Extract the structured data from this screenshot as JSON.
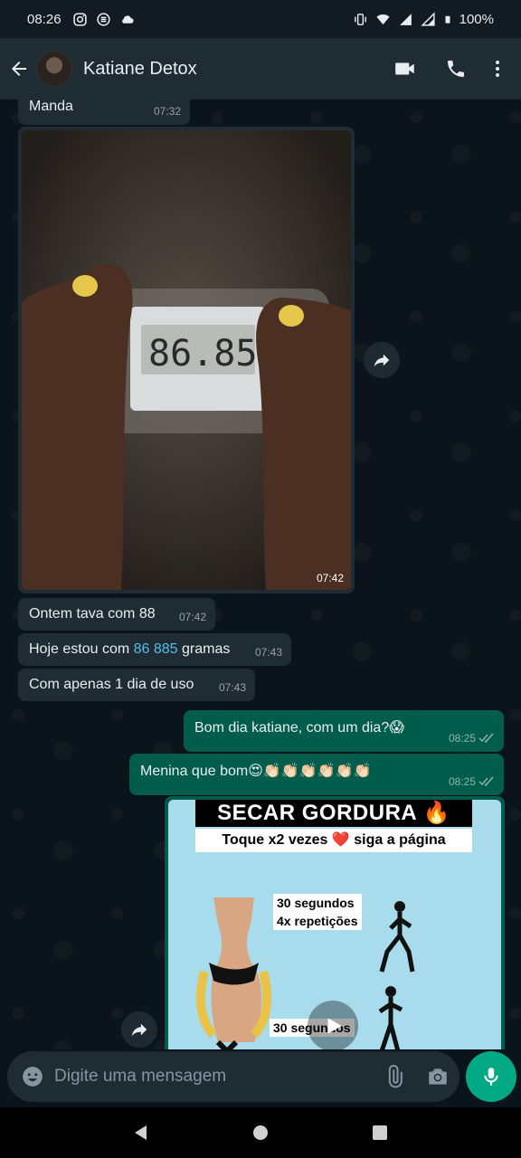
{
  "status_bar": {
    "time": "08:26",
    "battery": "100%"
  },
  "header": {
    "contact_name": "Katiane Detox"
  },
  "messages": [
    {
      "dir": "in",
      "text": "Manda",
      "time": "07:32"
    },
    {
      "dir": "in",
      "type": "image",
      "time": "07:42"
    },
    {
      "dir": "in",
      "text": "Ontem tava com 88",
      "time": "07:42"
    },
    {
      "dir": "in",
      "text_before": "Hoje estou com ",
      "link": "86 885",
      "text_after": " gramas",
      "time": "07:43"
    },
    {
      "dir": "in",
      "text": "Com apenas 1 dia de uso",
      "time": "07:43"
    },
    {
      "dir": "out",
      "text": "Bom dia katiane, com um dia?😱",
      "time": "08:25"
    },
    {
      "dir": "out",
      "text": "Menina que bom😍👏🏻👏🏻👏🏻👏🏻👏🏻👏🏻",
      "time": "08:25"
    },
    {
      "dir": "out",
      "type": "video",
      "poster": {
        "title": "SECAR GORDURA 🔥",
        "subtitle": "Toque x2 vezes ❤️ siga a página",
        "text1_line1": "30 segundos",
        "text1_line2": "4x repetições",
        "text2": "30 segundos"
      }
    }
  ],
  "input": {
    "placeholder": "Digite uma mensagem"
  },
  "colors": {
    "incoming_bubble": "#202c33",
    "outgoing_bubble": "#005c4b",
    "accent": "#00a884",
    "link": "#53bdeb"
  }
}
